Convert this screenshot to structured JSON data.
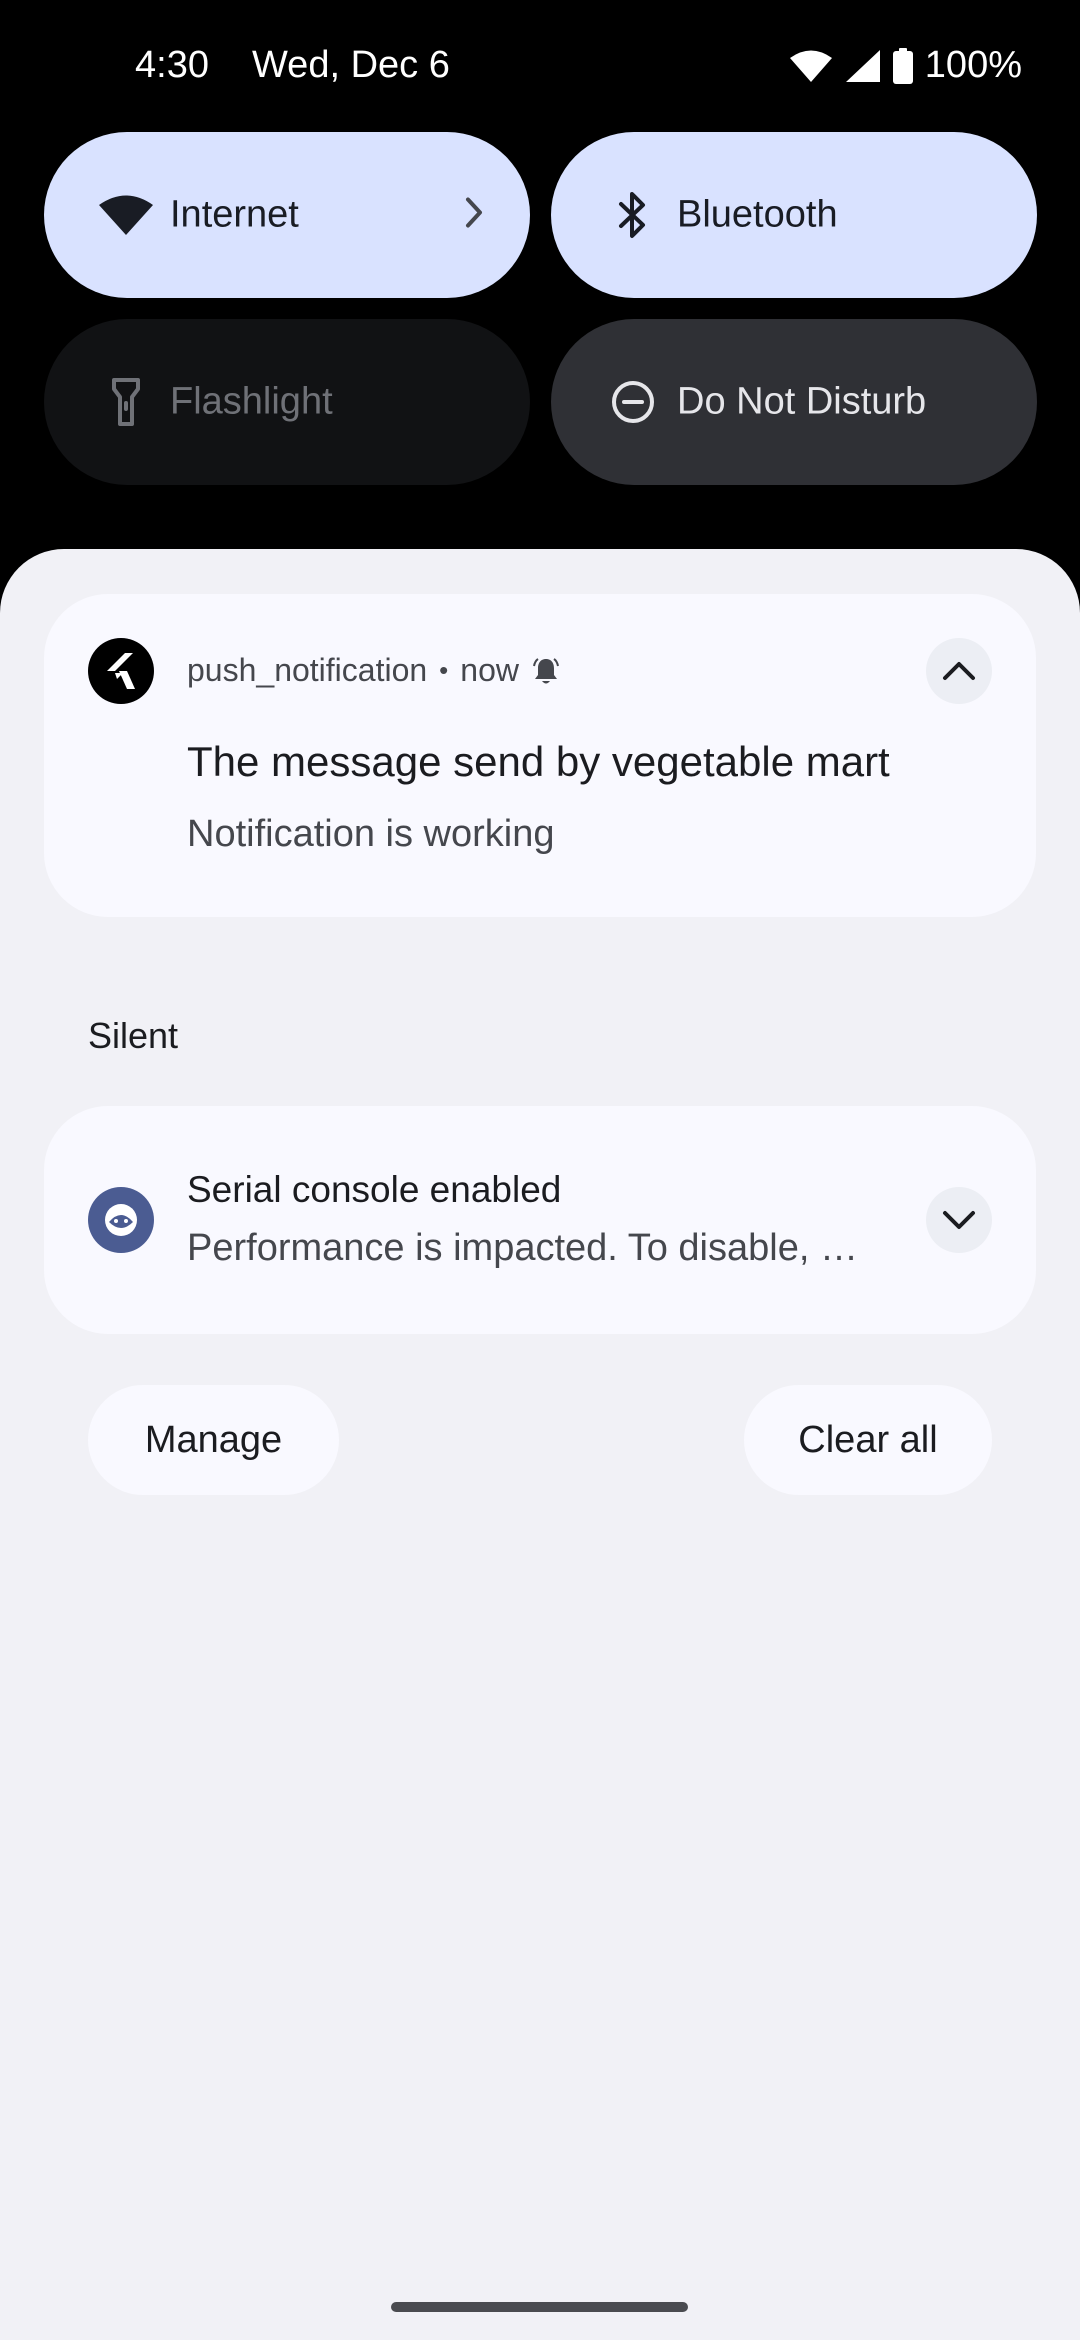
{
  "status_bar": {
    "time": "4:30",
    "date": "Wed, Dec 6",
    "battery": "100%",
    "icons": [
      "wifi-icon",
      "cell-signal-icon",
      "battery-icon"
    ]
  },
  "quick_settings": [
    {
      "label": "Internet",
      "icon": "wifi-icon",
      "state": "on",
      "has_chevron": true
    },
    {
      "label": "Bluetooth",
      "icon": "bluetooth-icon",
      "state": "on"
    },
    {
      "label": "Flashlight",
      "icon": "flashlight-icon",
      "state": "off"
    },
    {
      "label": "Do Not Disturb",
      "icon": "do-not-disturb-icon",
      "state": "off"
    }
  ],
  "notifications": [
    {
      "app": "push_notification",
      "time": "now",
      "separator": "•",
      "title": "The message send by vegetable mart",
      "text": "Notification is working",
      "icon": "flutter-app-icon",
      "alert_icon": "bell-icon",
      "expanded": true
    }
  ],
  "silent_section": {
    "label": "Silent",
    "notifications": [
      {
        "title": "Serial console enabled",
        "text": "Performance is impacted. To disable, …",
        "icon": "android-debug-icon",
        "expanded": false
      }
    ]
  },
  "actions": {
    "manage": "Manage",
    "clear_all": "Clear all"
  },
  "colors": {
    "tile_on": "#d9e2ff",
    "tile_off": "#111214",
    "tile_dnd": "#2f3035",
    "shade_bg": "#f1f1f6",
    "card_bg": "#f9f9ff",
    "serial_icon": "#4b5c92"
  }
}
